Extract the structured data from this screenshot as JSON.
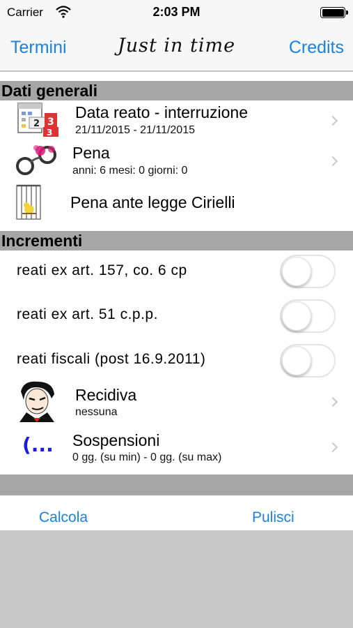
{
  "status": {
    "carrier": "Carrier",
    "time": "2:03 PM"
  },
  "nav": {
    "left": "Termini",
    "title": "Just in time",
    "right": "Credits"
  },
  "sections": {
    "general": "Dati generali",
    "increments": "Incrementi"
  },
  "rows": {
    "data_reato": {
      "title": "Data reato - interruzione",
      "subtitle": "21/11/2015  -  21/11/2015",
      "icon": "calendar-icon"
    },
    "pena": {
      "title": "Pena",
      "subtitle": "anni: 6 mesi: 0 giorni: 0",
      "icon": "handcuffs-icon"
    },
    "cirielli": {
      "title": "Pena ante legge Cirielli",
      "icon": "bird-cage-icon"
    },
    "recidiva": {
      "title": "Recidiva",
      "subtitle": "nessuna",
      "icon": "cartoon-face-icon"
    },
    "sospensioni": {
      "title": "Sospensioni",
      "subtitle": "0  gg. (su min)  -  0  gg. (su max)",
      "icon": "ellipsis-brackets-icon"
    }
  },
  "toggles": [
    {
      "label": "reati ex art. 157, co. 6 cp",
      "on": false
    },
    {
      "label": "reati ex art. 51 c.p.p.",
      "on": false
    },
    {
      "label": "reati fiscali (post 16.9.2011)",
      "on": false
    }
  ],
  "footer": {
    "calcola": "Calcola",
    "pulisci": "Pulisci"
  },
  "colors": {
    "accent": "#1a82e0",
    "section_bg": "#a6a6a6",
    "background": "#c8c8c8"
  }
}
